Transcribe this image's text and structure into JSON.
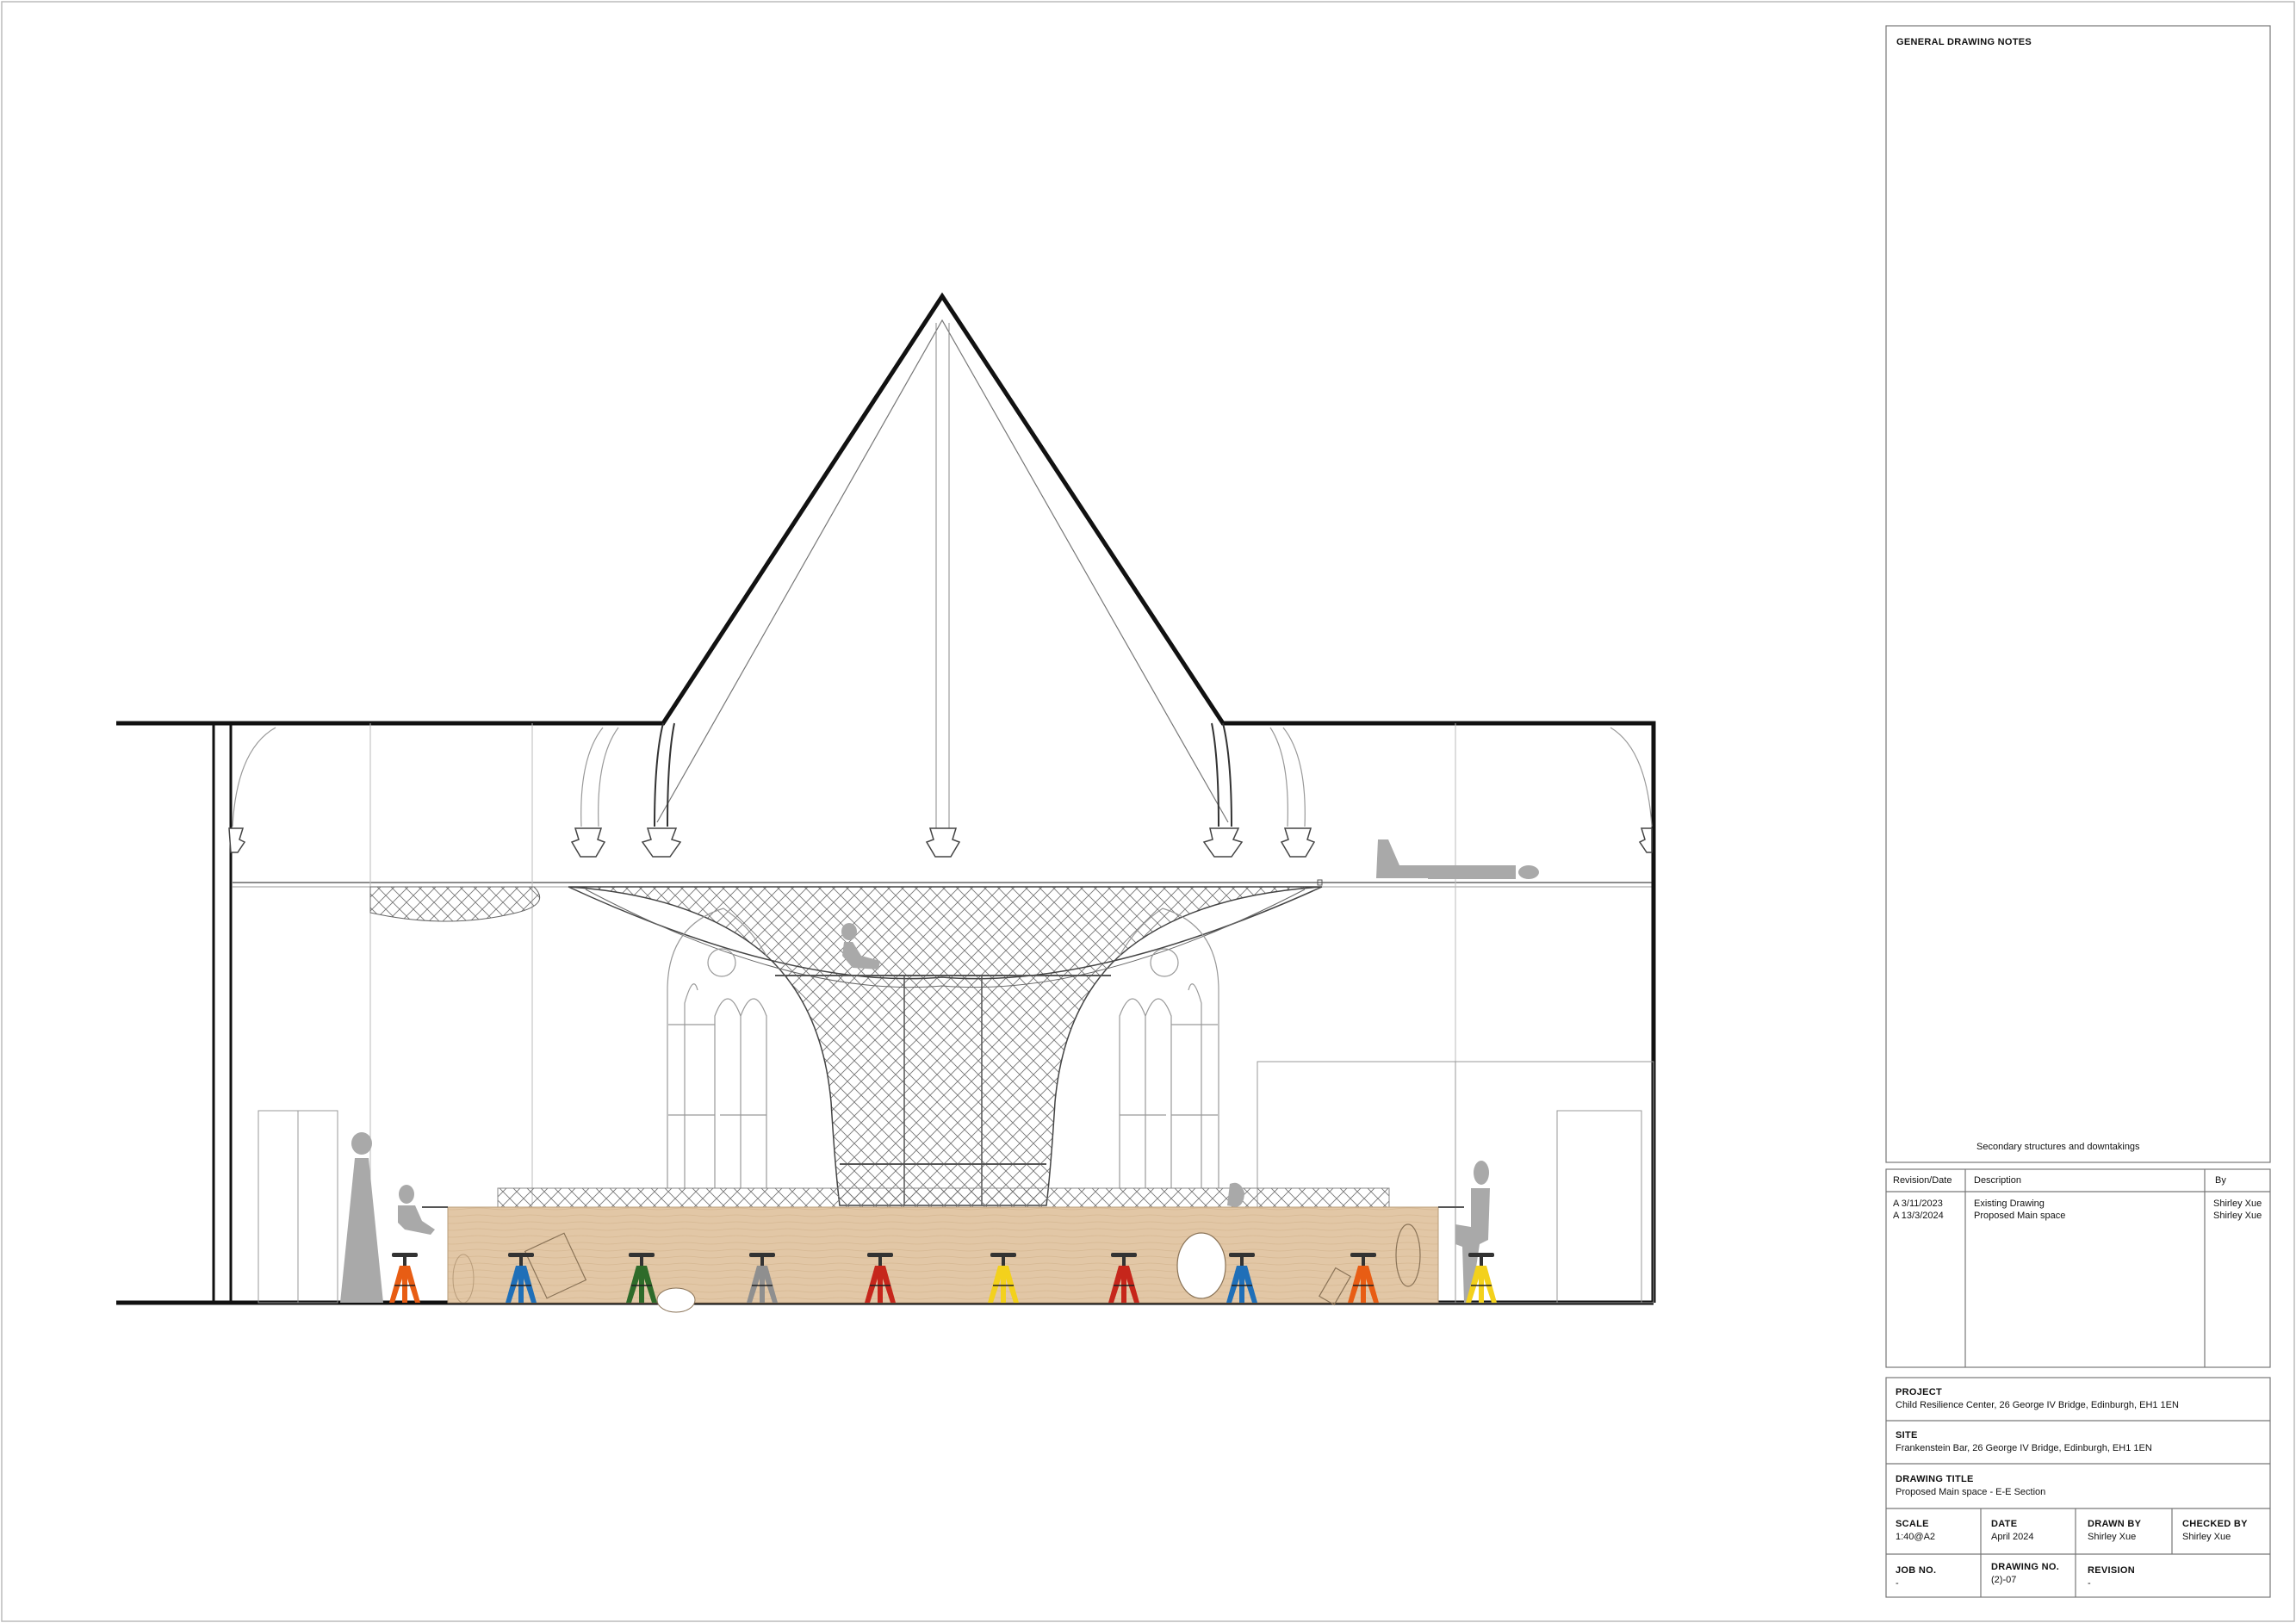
{
  "notes": {
    "heading": "GENERAL DRAWING NOTES",
    "legend": "Secondary structures and downtakings"
  },
  "revisions": {
    "headers": {
      "rev": "Revision/Date",
      "desc": "Description",
      "by": "By"
    },
    "rows": [
      {
        "rev": "A 3/11/2023",
        "desc": "Existing Drawing",
        "by": "Shirley Xue"
      },
      {
        "rev": "A 13/3/2024",
        "desc": "Proposed Main space",
        "by": "Shirley Xue"
      }
    ]
  },
  "title_block": {
    "project_label": "PROJECT",
    "project": "Child Resilience Center, 26 George IV Bridge, Edinburgh, EH1 1EN",
    "site_label": "SITE",
    "site": "Frankenstein Bar, 26 George IV Bridge, Edinburgh, EH1 1EN",
    "drawing_title_label": "DRAWING TITLE",
    "drawing_title": "Proposed Main space - E-E Section",
    "scale_label": "SCALE",
    "scale": "1:40@A2",
    "date_label": "DATE",
    "date": "April 2024",
    "drawn_by_label": "DRAWN BY",
    "drawn_by": "Shirley Xue",
    "checked_by_label": "CHECKED BY",
    "checked_by": "Shirley Xue",
    "job_no_label": "JOB NO.",
    "job_no": "-",
    "drawing_no_label": "DRAWING NO.",
    "drawing_no": "(2)-07",
    "revision_label": "REVISION",
    "revision": "-"
  },
  "colors": {
    "wood": "#e2c7a6",
    "figure": "#a9a9a9",
    "stool_seat": "#333333",
    "stools": [
      "#e85d14",
      "#1f6fb8",
      "#2e6b2a",
      "#8f8f8f",
      "#c6261b",
      "#f3d11c",
      "#c6261b",
      "#1f6fb8",
      "#e85d14",
      "#f3d11c"
    ]
  }
}
